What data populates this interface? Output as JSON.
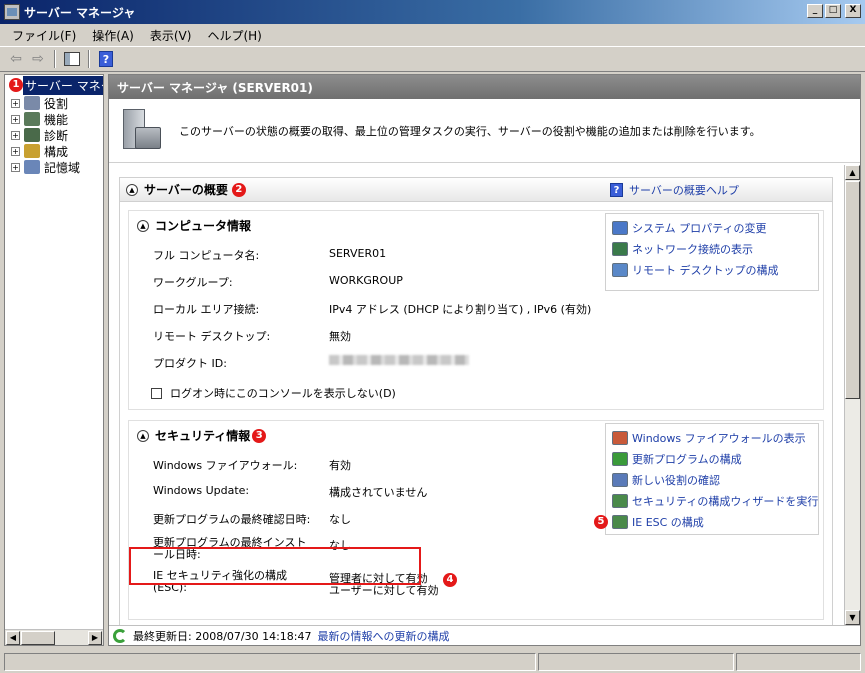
{
  "window": {
    "title": "サーバー マネージャ",
    "minimize": "_",
    "maximize": "□",
    "close": "X"
  },
  "menu": [
    {
      "label": "ファイル(F)"
    },
    {
      "label": "操作(A)"
    },
    {
      "label": "表示(V)"
    },
    {
      "label": "ヘルプ(H)"
    }
  ],
  "toolbar": {
    "back": "⇦",
    "forward": "⇨",
    "help": "?"
  },
  "tree": {
    "root": "サーバー マネー",
    "root_badge": "1",
    "items": [
      {
        "label": "役割",
        "icon_color": "#7a8aa8"
      },
      {
        "label": "機能",
        "icon_color": "#5a7a5a"
      },
      {
        "label": "診断",
        "icon_color": "#4a6a4a"
      },
      {
        "label": "構成",
        "icon_color": "#c8a030"
      },
      {
        "label": "記憶域",
        "icon_color": "#6a86b8"
      }
    ]
  },
  "main": {
    "header": "サーバー マネージャ (SERVER01)",
    "intro": "このサーバーの状態の概要の取得、最上位の管理タスクの実行、サーバーの役割や機能の追加または削除を行います。",
    "overview": {
      "title": "サーバーの概要",
      "badge": "2",
      "help_link": "サーバーの概要ヘルプ"
    },
    "computer_info": {
      "title": "コンピュータ情報",
      "fields": [
        {
          "label": "フル コンピュータ名:",
          "value": "SERVER01"
        },
        {
          "label": "ワークグループ:",
          "value": "WORKGROUP"
        },
        {
          "label": "ローカル エリア接続:",
          "value": "IPv4 アドレス (DHCP により割り当て) , IPv6 (有効)"
        },
        {
          "label": "リモート デスクトップ:",
          "value": "無効"
        },
        {
          "label": "プロダクト ID:",
          "value": ""
        }
      ],
      "checkbox_label": "ログオン時にこのコンソールを表示しない(D)",
      "tasks": [
        {
          "label": "システム プロパティの変更",
          "icon_color": "#4a78c8"
        },
        {
          "label": "ネットワーク接続の表示",
          "icon_color": "#3a7a4a"
        },
        {
          "label": "リモート デスクトップの構成",
          "icon_color": "#5a88c8"
        }
      ]
    },
    "security_info": {
      "title": "セキュリティ情報",
      "badge": "3",
      "fields": [
        {
          "label": "Windows ファイアウォール:",
          "value": "有効"
        },
        {
          "label": "Windows Update:",
          "value": "構成されていません"
        },
        {
          "label": "更新プログラムの最終確認日時:",
          "value": "なし"
        },
        {
          "label": "更新プログラムの最終インストール日時:",
          "value": "なし"
        }
      ],
      "esc": {
        "label": "IE セキュリティ強化の構成 (ESC):",
        "value_admin": "管理者に対して有効",
        "value_user": "ユーザーに対して有効",
        "badge": "4"
      },
      "tasks": [
        {
          "label": "Windows ファイアウォールの表示",
          "icon_color": "#c85a3a"
        },
        {
          "label": "更新プログラムの構成",
          "icon_color": "#3a9a3a"
        },
        {
          "label": "新しい役割の確認",
          "icon_color": "#5a7ab8"
        },
        {
          "label": "セキュリティの構成ウィザードを実行",
          "icon_color": "#4a8a4a"
        },
        {
          "label": "IE ESC の構成",
          "icon_color": "#4a8a4a"
        }
      ],
      "task_badge": "5"
    },
    "status": {
      "last_updated": "最終更新日: 2008/07/30 14:18:47",
      "configure_link": "最新の情報への更新の構成"
    }
  }
}
